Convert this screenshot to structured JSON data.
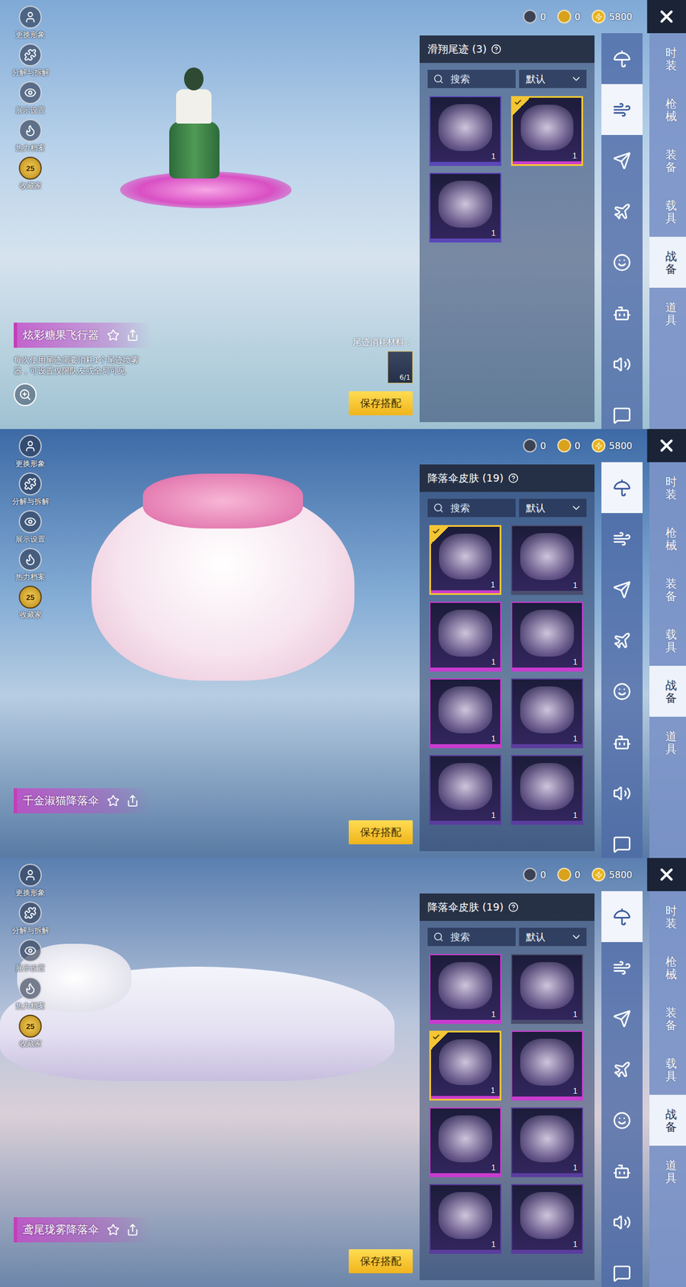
{
  "panels": [
    {
      "left_menu": [
        {
          "label": "更换形象"
        },
        {
          "label": "分解与拆解"
        },
        {
          "label": "展示设置"
        },
        {
          "label": "热力档案"
        },
        {
          "label": "收藏家",
          "badge": "25"
        }
      ],
      "currency": [
        {
          "value": "0"
        },
        {
          "value": "0"
        },
        {
          "value": "5800"
        }
      ],
      "category_icons": [
        {
          "selected": false
        },
        {
          "selected": true
        },
        {
          "selected": false
        },
        {
          "selected": false
        },
        {
          "selected": false
        },
        {
          "selected": false
        },
        {
          "selected": false
        },
        {
          "selected": false
        }
      ],
      "tabs": [
        {
          "label": "时装",
          "selected": false
        },
        {
          "label": "枪械",
          "selected": false
        },
        {
          "label": "装备",
          "selected": false
        },
        {
          "label": "载具",
          "selected": false
        },
        {
          "label": "战备",
          "selected": true
        },
        {
          "label": "道具",
          "selected": false
        }
      ],
      "list": {
        "title": "滑翔尾迹 (3)",
        "search_placeholder": "搜索",
        "sort": "默认"
      },
      "items": [
        {
          "count": "1",
          "selected": false,
          "color": "#5a48b8"
        },
        {
          "count": "1",
          "selected": true,
          "color": "#c83ccf"
        },
        {
          "count": "1",
          "selected": false,
          "color": "#5a48b8"
        }
      ],
      "item_name": "炫彩糖果飞行器",
      "description": "每次使用尾迹需要消耗1个尾迹喷雾器，可设置仅限队友或全局可见",
      "material": {
        "label": "尾迹消耗材料：",
        "amount": "6/1"
      },
      "save_button": "保存搭配"
    },
    {
      "left_menu": [
        {
          "label": "更换形象"
        },
        {
          "label": "分解与拆解"
        },
        {
          "label": "展示设置"
        },
        {
          "label": "热力档案"
        },
        {
          "label": "收藏家",
          "badge": "25"
        }
      ],
      "currency": [
        {
          "value": "0"
        },
        {
          "value": "0"
        },
        {
          "value": "5800"
        }
      ],
      "category_icons": [
        {
          "selected": true
        },
        {
          "selected": false
        },
        {
          "selected": false
        },
        {
          "selected": false
        },
        {
          "selected": false
        },
        {
          "selected": false
        },
        {
          "selected": false
        },
        {
          "selected": false
        }
      ],
      "tabs": [
        {
          "label": "时装",
          "selected": false
        },
        {
          "label": "枪械",
          "selected": false
        },
        {
          "label": "装备",
          "selected": false
        },
        {
          "label": "载具",
          "selected": false
        },
        {
          "label": "战备",
          "selected": true
        },
        {
          "label": "道具",
          "selected": false
        }
      ],
      "list": {
        "title": "降落伞皮肤 (19)",
        "search_placeholder": "搜索",
        "sort": "默认"
      },
      "items": [
        {
          "count": "1",
          "selected": true,
          "color": "#c83ccf"
        },
        {
          "count": "1",
          "selected": false,
          "color": "#4a4e6e"
        },
        {
          "count": "1",
          "selected": false,
          "color": "#c83ccf"
        },
        {
          "count": "1",
          "selected": false,
          "color": "#c83ccf"
        },
        {
          "count": "1",
          "selected": false,
          "color": "#c83ccf"
        },
        {
          "count": "1",
          "selected": false,
          "color": "#5b3d9e"
        },
        {
          "count": "1",
          "selected": false,
          "color": "#5b3d9e"
        },
        {
          "count": "1",
          "selected": false,
          "color": "#5b3d9e"
        }
      ],
      "item_name": "千金淑猫降落伞",
      "save_button": "保存搭配"
    },
    {
      "left_menu": [
        {
          "label": "更换形象"
        },
        {
          "label": "分解与拆解"
        },
        {
          "label": "展示设置"
        },
        {
          "label": "热力档案"
        },
        {
          "label": "收藏家",
          "badge": "25"
        }
      ],
      "currency": [
        {
          "value": "0"
        },
        {
          "value": "0"
        },
        {
          "value": "5800"
        }
      ],
      "category_icons": [
        {
          "selected": true
        },
        {
          "selected": false
        },
        {
          "selected": false
        },
        {
          "selected": false
        },
        {
          "selected": false
        },
        {
          "selected": false
        },
        {
          "selected": false
        },
        {
          "selected": false
        }
      ],
      "tabs": [
        {
          "label": "时装",
          "selected": false
        },
        {
          "label": "枪械",
          "selected": false
        },
        {
          "label": "装备",
          "selected": false
        },
        {
          "label": "载具",
          "selected": false
        },
        {
          "label": "战备",
          "selected": true
        },
        {
          "label": "道具",
          "selected": false
        }
      ],
      "list": {
        "title": "降落伞皮肤 (19)",
        "search_placeholder": "搜索",
        "sort": "默认"
      },
      "items": [
        {
          "count": "1",
          "selected": false,
          "color": "#c83ccf"
        },
        {
          "count": "1",
          "selected": false,
          "color": "#4a4e6e"
        },
        {
          "count": "1",
          "selected": true,
          "color": "#c83ccf"
        },
        {
          "count": "1",
          "selected": false,
          "color": "#c83ccf"
        },
        {
          "count": "1",
          "selected": false,
          "color": "#c83ccf"
        },
        {
          "count": "1",
          "selected": false,
          "color": "#5b3d9e"
        },
        {
          "count": "1",
          "selected": false,
          "color": "#5b3d9e"
        },
        {
          "count": "1",
          "selected": false,
          "color": "#5b3d9e"
        }
      ],
      "item_name": "鸢尾珑雾降落伞",
      "save_button": "保存搭配"
    }
  ]
}
